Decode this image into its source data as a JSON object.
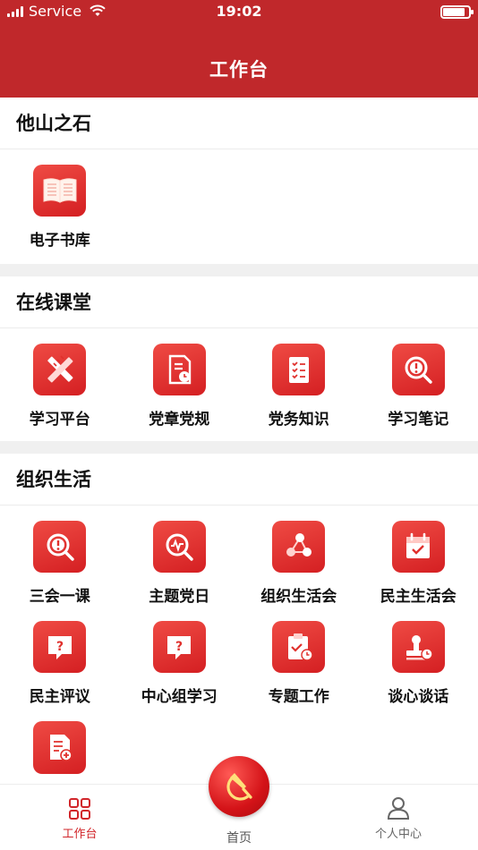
{
  "status_bar": {
    "carrier": "Service",
    "time": "19:02"
  },
  "header": {
    "title": "工作台"
  },
  "sections": [
    {
      "title": "他山之石",
      "items": [
        {
          "label": "电子书库",
          "icon": "book-icon"
        }
      ]
    },
    {
      "title": "在线课堂",
      "items": [
        {
          "label": "学习平台",
          "icon": "pencil-ruler-icon"
        },
        {
          "label": "党章党规",
          "icon": "document-stamp-icon"
        },
        {
          "label": "党务知识",
          "icon": "checklist-icon"
        },
        {
          "label": "学习笔记",
          "icon": "magnifier-alert-icon"
        }
      ]
    },
    {
      "title": "组织生活",
      "items": [
        {
          "label": "三会一课",
          "icon": "magnifier-alert-icon"
        },
        {
          "label": "主题党日",
          "icon": "magnifier-pulse-icon"
        },
        {
          "label": "组织生活会",
          "icon": "share-icon"
        },
        {
          "label": "民主生活会",
          "icon": "calendar-check-icon"
        },
        {
          "label": "民主评议",
          "icon": "question-bubble-icon"
        },
        {
          "label": "中心组学习",
          "icon": "question-bubble-icon"
        },
        {
          "label": "专题工作",
          "icon": "clipboard-clock-icon"
        },
        {
          "label": "谈心谈话",
          "icon": "seal-clock-icon"
        },
        {
          "label": "",
          "icon": "document-add-icon"
        }
      ]
    }
  ],
  "tabbar": {
    "work_label": "工作台",
    "home_label": "首页",
    "me_label": "个人中心"
  },
  "colors": {
    "brand": "#c0282b",
    "icon_bg": "#e0302c"
  }
}
